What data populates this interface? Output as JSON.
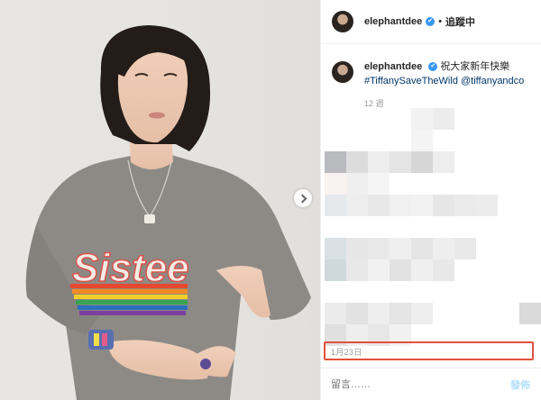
{
  "post": {
    "username": "elephantdee",
    "follow_separator": "•",
    "follow_status": "追蹤中",
    "verified_mark": "✔",
    "caption_text": "祝大家新年快樂",
    "hashtag": "#TiffanySaveTheWild",
    "mention": "@tiffanyandco",
    "time_ago": "12 週",
    "date": "1月23日",
    "comment_placeholder": "留言……",
    "post_button": "發佈",
    "sweater_text": "Sistee"
  },
  "colors": {
    "highlight_border": "#e0513b",
    "link": "#003569",
    "verified": "#3897f0",
    "post_disabled": "#b2dffc"
  }
}
